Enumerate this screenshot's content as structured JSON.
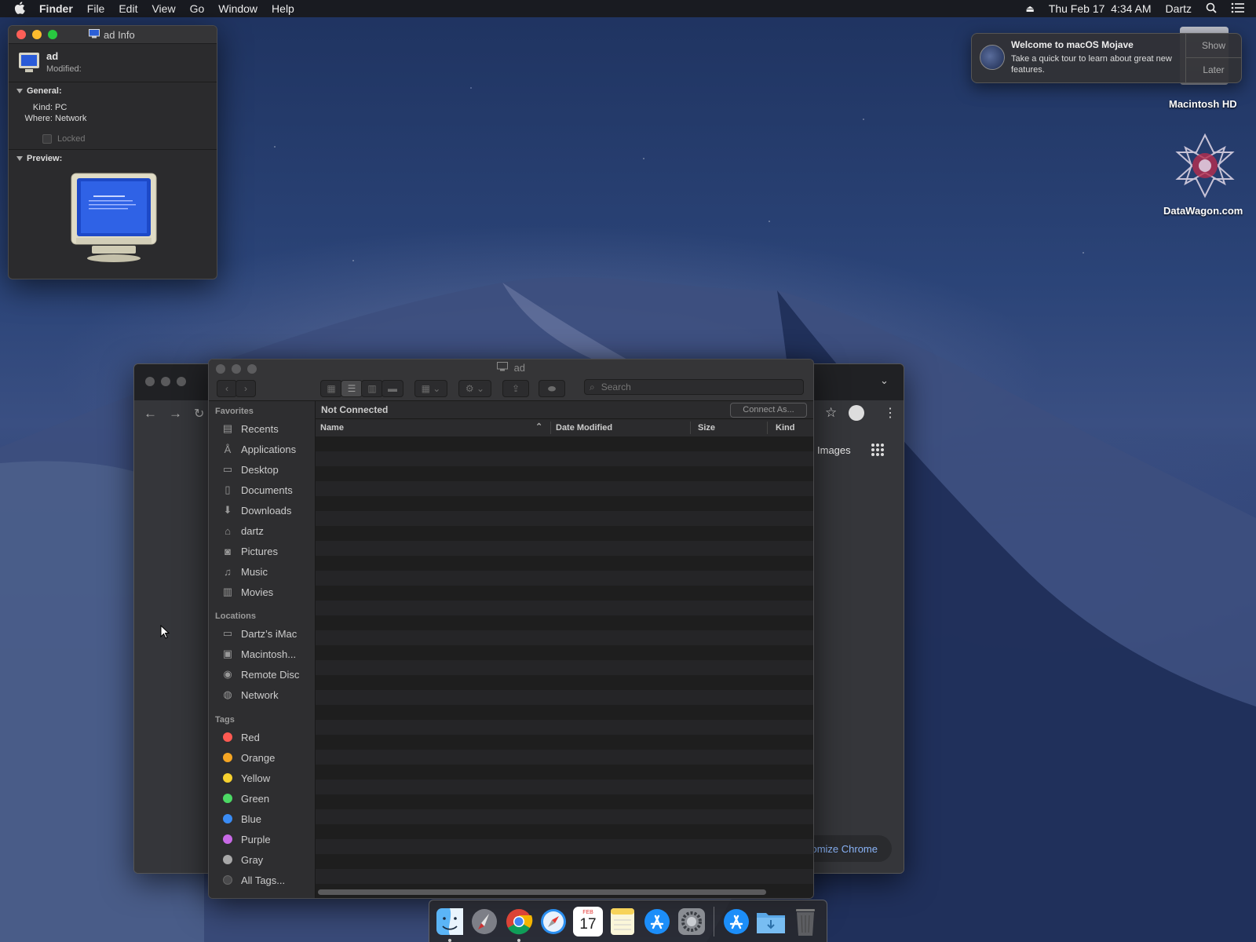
{
  "menubar": {
    "app_name": "Finder",
    "menus": [
      "File",
      "Edit",
      "View",
      "Go",
      "Window",
      "Help"
    ],
    "datetime": "Thu Feb 17  4:34 AM",
    "user": "Dartz"
  },
  "info_window": {
    "title": "ad Info",
    "name": "ad",
    "modified_label": "Modified:",
    "general_label": "General:",
    "kind_label": "Kind:",
    "kind_value": "PC",
    "where_label": "Where:",
    "where_value": "Network",
    "locked_label": "Locked",
    "preview_label": "Preview:"
  },
  "finder": {
    "title": "ad",
    "search_placeholder": "Search",
    "status": "Not Connected",
    "connect_button": "Connect As...",
    "columns": {
      "name": "Name",
      "date_modified": "Date Modified",
      "size": "Size",
      "kind": "Kind"
    },
    "sidebar": {
      "favorites_label": "Favorites",
      "favorites": [
        {
          "label": "Recents",
          "icon": "recents-icon"
        },
        {
          "label": "Applications",
          "icon": "applications-icon"
        },
        {
          "label": "Desktop",
          "icon": "desktop-icon"
        },
        {
          "label": "Documents",
          "icon": "documents-icon"
        },
        {
          "label": "Downloads",
          "icon": "downloads-icon"
        },
        {
          "label": "dartz",
          "icon": "home-icon"
        },
        {
          "label": "Pictures",
          "icon": "pictures-icon"
        },
        {
          "label": "Music",
          "icon": "music-icon"
        },
        {
          "label": "Movies",
          "icon": "movies-icon"
        }
      ],
      "locations_label": "Locations",
      "locations": [
        {
          "label": "Dartz’s iMac",
          "icon": "imac-icon"
        },
        {
          "label": "Macintosh...",
          "icon": "disk-icon"
        },
        {
          "label": "Remote Disc",
          "icon": "remote-disc-icon"
        },
        {
          "label": "Network",
          "icon": "network-icon"
        }
      ],
      "tags_label": "Tags",
      "tags": [
        {
          "label": "Red",
          "color": "#ff5a52"
        },
        {
          "label": "Orange",
          "color": "#f5a623"
        },
        {
          "label": "Yellow",
          "color": "#f7d12f"
        },
        {
          "label": "Green",
          "color": "#4cd964"
        },
        {
          "label": "Blue",
          "color": "#3a8cf5"
        },
        {
          "label": "Purple",
          "color": "#c869e6"
        },
        {
          "label": "Gray",
          "color": "#a8a8a8"
        },
        {
          "label": "All Tags...",
          "color": "#4a4a4c"
        }
      ]
    }
  },
  "chrome": {
    "images_link": "Images",
    "customize": "omize Chrome"
  },
  "notification": {
    "title": "Welcome to macOS Mojave",
    "body": "Take a quick tour to learn about great new features.",
    "show_button": "Show",
    "later_button": "Later"
  },
  "desktop": {
    "icons": [
      {
        "label": "Macintosh HD"
      },
      {
        "label": "DataWagon.com"
      }
    ]
  },
  "dock": {
    "calendar_month": "FEB",
    "calendar_day": "17",
    "apps": [
      "finder-icon",
      "launchpad-icon",
      "chrome-icon",
      "safari-icon",
      "calendar-icon",
      "notes-icon",
      "app-store-icon",
      "system-preferences-icon",
      "app-store-folder-icon",
      "downloads-folder-icon",
      "trash-icon"
    ]
  },
  "colors": {
    "close": "#ff5f57",
    "minimize": "#febc2e",
    "zoom": "#28c840",
    "link_blue": "#8ab4f8"
  }
}
